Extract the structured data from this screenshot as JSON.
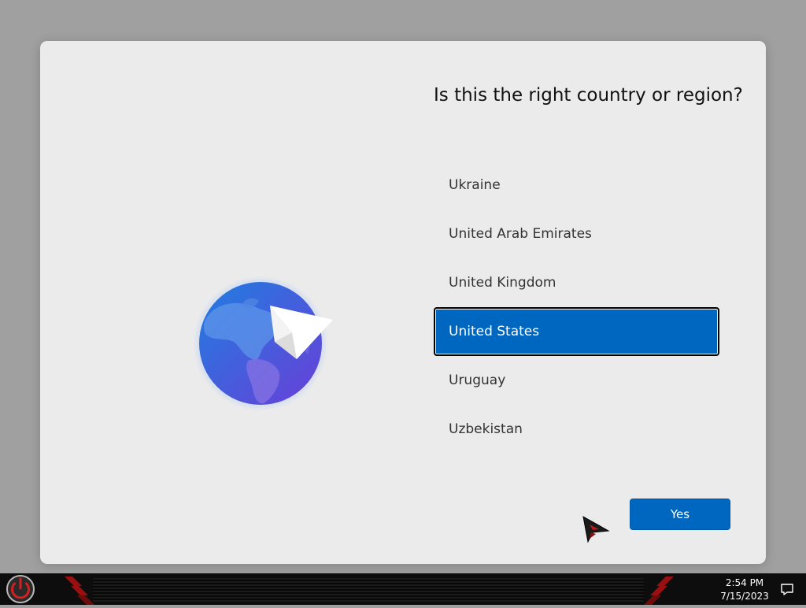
{
  "dialog": {
    "title": "Is this the right country or region?",
    "illustration": "globe-with-paper-plane",
    "countries": [
      {
        "label": "Ukraine",
        "selected": false
      },
      {
        "label": "United Arab Emirates",
        "selected": false
      },
      {
        "label": "United Kingdom",
        "selected": false
      },
      {
        "label": "United States",
        "selected": true
      },
      {
        "label": "Uruguay",
        "selected": false
      },
      {
        "label": "Uzbekistan",
        "selected": false
      }
    ],
    "yes_label": "Yes"
  },
  "taskbar": {
    "power_icon": "power-icon",
    "time": "2:54 PM",
    "date": "7/15/2023",
    "notification_icon": "notification-icon"
  },
  "colors": {
    "accent": "#0067c0",
    "dialog_background": "#ebebeb",
    "desktop_background": "#a0a0a0",
    "taskbar_background": "#0d0d0d"
  }
}
